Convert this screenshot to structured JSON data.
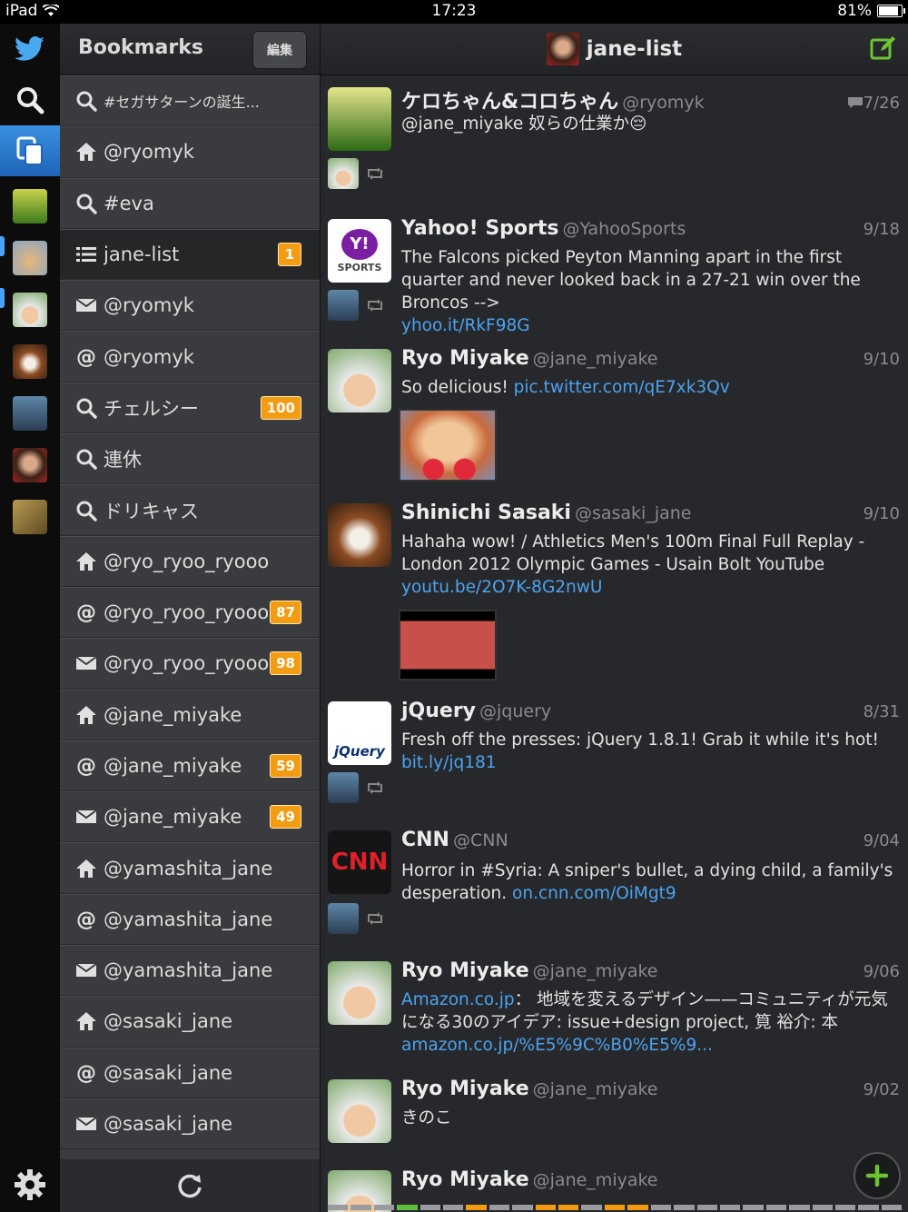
{
  "status_bar": {
    "device": "iPad",
    "time": "17:23",
    "battery": "81%",
    "battery_level": 0.81
  },
  "bookmarks": {
    "title": "Bookmarks",
    "edit_label": "編集",
    "items": [
      {
        "icon": "search-icon",
        "label": "#セガサターンの誕生...",
        "badge": ""
      },
      {
        "icon": "home-icon",
        "label": "@ryomyk",
        "badge": ""
      },
      {
        "icon": "search-icon",
        "label": "#eva",
        "badge": ""
      },
      {
        "icon": "list-icon",
        "label": "jane-list",
        "badge": "1"
      },
      {
        "icon": "mail-icon",
        "label": "@ryomyk",
        "badge": ""
      },
      {
        "icon": "at-icon",
        "label": "@ryomyk",
        "badge": ""
      },
      {
        "icon": "search-icon",
        "label": "チェルシー",
        "badge": "100"
      },
      {
        "icon": "search-icon",
        "label": "連休",
        "badge": ""
      },
      {
        "icon": "search-icon",
        "label": "ドリキャス",
        "badge": ""
      },
      {
        "icon": "home-icon",
        "label": "@ryo_ryoo_ryooo",
        "badge": ""
      },
      {
        "icon": "at-icon",
        "label": "@ryo_ryoo_ryooo",
        "badge": "87"
      },
      {
        "icon": "mail-icon",
        "label": "@ryo_ryoo_ryooo",
        "badge": "98"
      },
      {
        "icon": "home-icon",
        "label": "@jane_miyake",
        "badge": ""
      },
      {
        "icon": "at-icon",
        "label": "@jane_miyake",
        "badge": "59"
      },
      {
        "icon": "mail-icon",
        "label": "@jane_miyake",
        "badge": "49"
      },
      {
        "icon": "home-icon",
        "label": "@yamashita_jane",
        "badge": ""
      },
      {
        "icon": "at-icon",
        "label": "@yamashita_jane",
        "badge": ""
      },
      {
        "icon": "mail-icon",
        "label": "@yamashita_jane",
        "badge": ""
      },
      {
        "icon": "home-icon",
        "label": "@sasaki_jane",
        "badge": ""
      },
      {
        "icon": "at-icon",
        "label": "@sasaki_jane",
        "badge": ""
      },
      {
        "icon": "mail-icon",
        "label": "@sasaki_jane",
        "badge": ""
      }
    ]
  },
  "timeline": {
    "title": "jane-list",
    "tweets": [
      {
        "name": "ケロちゃん&コロちゃん",
        "handle": "@ryomyk",
        "date": "7/26",
        "text": "@jane_miyake 奴らの仕業か😔",
        "link": ""
      },
      {
        "name": "Yahoo! Sports",
        "handle": "@YahooSports",
        "date": "9/18",
        "text": "The Falcons picked Peyton Manning apart in the first quarter and never looked back in a 27-21 win over the Broncos -->",
        "link": "yhoo.it/RkF98G"
      },
      {
        "name": "Ryo Miyake",
        "handle": "@jane_miyake",
        "date": "9/10",
        "text": "So delicious!",
        "link": "pic.twitter.com/qE7xk3Qv"
      },
      {
        "name": "Shinichi Sasaki",
        "handle": "@sasaki_jane",
        "date": "9/10",
        "text": "Hahaha wow! / Athletics Men's 100m Final Full Replay - London 2012 Olympic Games - Usain Bolt YouTube",
        "link": "youtu.be/2O7K-8G2nwU"
      },
      {
        "name": "jQuery",
        "handle": "@jquery",
        "date": "8/31",
        "text": "Fresh off the presses: jQuery 1.8.1! Grab it while it's hot!",
        "link": "bit.ly/jq181"
      },
      {
        "name": "CNN",
        "handle": "@CNN",
        "date": "9/04",
        "text": "Horror in #Syria: A sniper's bullet, a dying child, a family's desperation.",
        "link": "on.cnn.com/OiMgt9"
      },
      {
        "name": "Ryo Miyake",
        "handle": "@jane_miyake",
        "date": "9/06",
        "link_pre": "Amazon.co.jp",
        "text": "： 地域を変えるデザイン——コミュニティが元気になる30のアイデア: issue+design project, 筧 裕介: 本",
        "link": "amazon.co.jp/%E5%9C%B0%E5%9..."
      },
      {
        "name": "Ryo Miyake",
        "handle": "@jane_miyake",
        "date": "9/02",
        "text": "きのこ",
        "link": ""
      },
      {
        "name": "Ryo Miyake",
        "handle": "@jane_miyake",
        "date": "",
        "text": "",
        "link": ""
      }
    ]
  },
  "logos": {
    "yahoo": "Y!",
    "yahoo_sub": "SPORTS",
    "jquery": "jQuery",
    "cnn": "CNN"
  },
  "colors": {
    "accent_blue": "#3a8fe0",
    "badge_orange": "#f39c12",
    "link_blue": "#4ba3f0",
    "compose_green": "#6cc431"
  }
}
